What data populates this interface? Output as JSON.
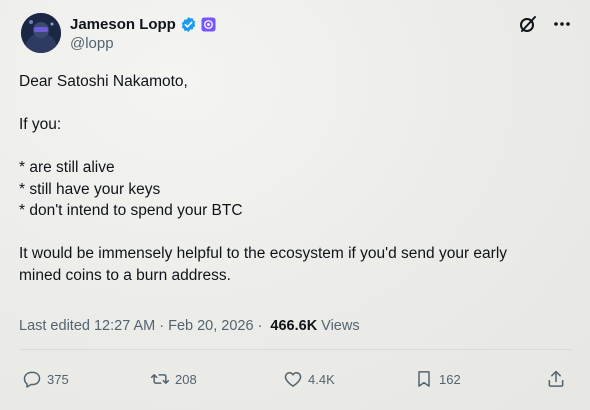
{
  "author": {
    "display_name": "Jameson Lopp",
    "handle": "@lopp"
  },
  "tweet": {
    "lines": [
      "Dear Satoshi Nakamoto,",
      "If you:",
      "* are still alive",
      "* still have your keys",
      "* don't intend to spend your BTC",
      "It would be immensely helpful to the ecosystem if you'd send your early",
      "mined coins to a burn address."
    ]
  },
  "meta": {
    "edited": "Last edited 12:27 AM",
    "separator": "·",
    "date": "Feb 20, 2026",
    "views_count": "466.6K",
    "views_label": "Views"
  },
  "actions": {
    "replies": "375",
    "reposts": "208",
    "likes": "4.4K",
    "bookmarks": "162"
  },
  "icons": {
    "verified": "verified-badge-icon",
    "affiliate": "affiliate-badge-icon",
    "grok": "grok-icon",
    "more": "more-options-icon",
    "reply": "reply-icon",
    "repost": "repost-icon",
    "like": "like-icon",
    "bookmark": "bookmark-icon",
    "share": "share-icon"
  },
  "colors": {
    "verified": "#1d9bf0",
    "affiliate": "#7856ff",
    "text": "#0f1419",
    "secondary": "#536471"
  }
}
